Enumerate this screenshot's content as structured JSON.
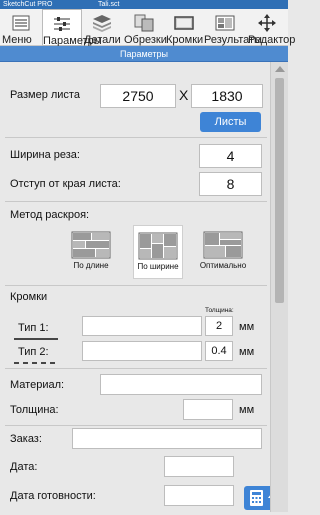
{
  "titlebar": {
    "app": "SketchCut PRO",
    "file": "Tali.sct"
  },
  "toolbar": [
    {
      "label": "Меню",
      "icon": "menu-icon"
    },
    {
      "label": "Параметры",
      "icon": "sliders-icon"
    },
    {
      "label": "Детали",
      "icon": "layers-icon"
    },
    {
      "label": "Обрезки",
      "icon": "offcuts-icon"
    },
    {
      "label": "Кромки",
      "icon": "edge-icon"
    },
    {
      "label": "Результаты",
      "icon": "results-icon"
    },
    {
      "label": "Редактор",
      "icon": "move-icon"
    }
  ],
  "panel": {
    "title": "Параметры"
  },
  "sheet": {
    "label": "Размер листа",
    "width": "2750",
    "x": "X",
    "height": "1830",
    "button": "Листы"
  },
  "kerf": {
    "label": "Ширина реза:",
    "value": "4"
  },
  "margin": {
    "label": "Отступ от края листа:",
    "value": "8"
  },
  "method": {
    "label": "Метод раскроя:",
    "options": [
      "По длине",
      "По ширине",
      "Оптимально"
    ],
    "selected": "По ширине"
  },
  "edges": {
    "label": "Кромки",
    "thickness_label": "Толщина:",
    "type1": {
      "label": "Тип 1:",
      "name": "",
      "thickness": "2",
      "unit": "мм"
    },
    "type2": {
      "label": "Тип 2:",
      "name": "",
      "thickness": "0.4",
      "unit": "мм"
    }
  },
  "material": {
    "label": "Материал:",
    "value": ""
  },
  "thickness": {
    "label": "Толщина:",
    "value": "",
    "unit": "мм"
  },
  "order": {
    "label": "Заказ:",
    "value": "",
    "date_label": "Дата:",
    "date_value": "",
    "ready_label": "Дата готовности:",
    "ready_value": ""
  },
  "colors": {
    "accent": "#3e84d6",
    "header": "#4f8bd0",
    "titlebar": "#2f6fb5"
  }
}
